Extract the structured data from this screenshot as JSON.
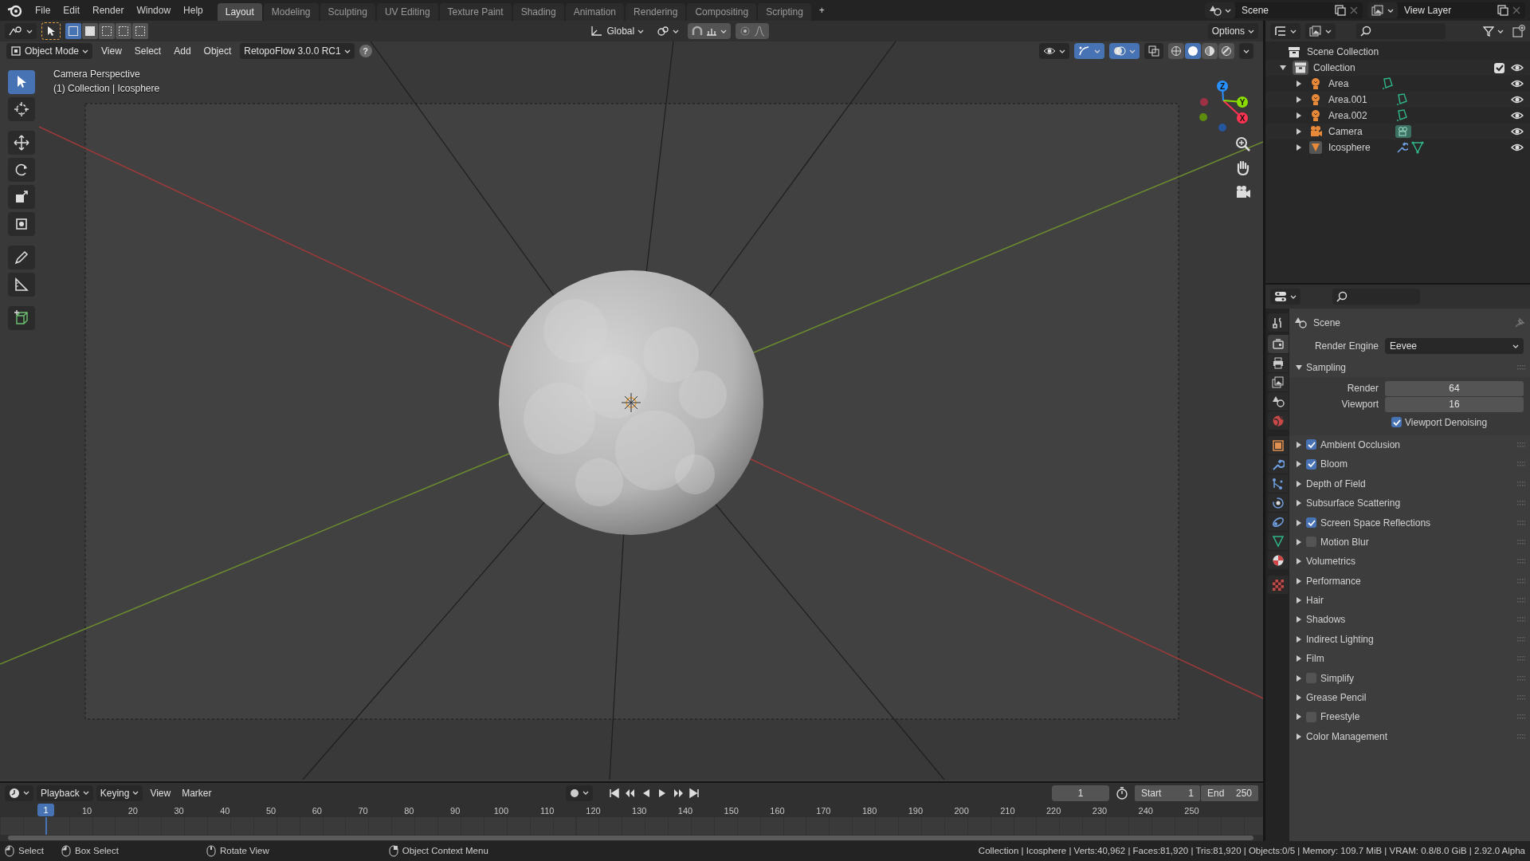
{
  "top_bar": {
    "menus": [
      "File",
      "Edit",
      "Render",
      "Window",
      "Help"
    ],
    "workspace_tabs": [
      {
        "label": "Layout",
        "selected": true
      },
      {
        "label": "Modeling",
        "selected": false
      },
      {
        "label": "Sculpting",
        "selected": false
      },
      {
        "label": "UV Editing",
        "selected": false
      },
      {
        "label": "Texture Paint",
        "selected": false
      },
      {
        "label": "Shading",
        "selected": false
      },
      {
        "label": "Animation",
        "selected": false
      },
      {
        "label": "Rendering",
        "selected": false
      },
      {
        "label": "Compositing",
        "selected": false
      },
      {
        "label": "Scripting",
        "selected": false
      }
    ],
    "add_workspace": "+",
    "scene": "Scene",
    "view_layer": "View Layer"
  },
  "viewport": {
    "transform_orientation": "Global",
    "options": "Options",
    "mode": "Object Mode",
    "menus": [
      "View",
      "Select",
      "Add",
      "Object"
    ],
    "addon": "RetopoFlow 3.0.0 RC1",
    "help": "?",
    "overlay_text": [
      "Camera Perspective",
      "(1) Collection | Icosphere"
    ],
    "gizmo_labels": [
      "X",
      "Y",
      "Z"
    ]
  },
  "outliner": {
    "root": "Scene Collection",
    "collection": {
      "label": "Collection",
      "expanded": true,
      "checked": true,
      "visible": true,
      "children": [
        {
          "label": "Area",
          "kind": "light",
          "expanded": false,
          "has_modifier": false,
          "visible": true
        },
        {
          "label": "Area.001",
          "kind": "light",
          "expanded": false,
          "has_modifier": false,
          "visible": true
        },
        {
          "label": "Area.002",
          "kind": "light",
          "expanded": false,
          "has_modifier": false,
          "visible": true
        },
        {
          "label": "Camera",
          "kind": "camera",
          "expanded": false,
          "has_modifier": false,
          "visible": true
        },
        {
          "label": "Icosphere",
          "kind": "mesh",
          "expanded": false,
          "has_modifier": true,
          "visible": true
        }
      ]
    }
  },
  "properties": {
    "tabs": [
      {
        "kind": "tool",
        "selected": false
      },
      {
        "kind": "render",
        "selected": true
      },
      {
        "kind": "output",
        "selected": false
      },
      {
        "kind": "view_layer",
        "selected": false
      },
      {
        "kind": "scene",
        "selected": false
      },
      {
        "kind": "world",
        "selected": false
      },
      {
        "kind": "object",
        "selected": false
      },
      {
        "kind": "modifiers",
        "selected": false
      },
      {
        "kind": "particles",
        "selected": false
      },
      {
        "kind": "physics",
        "selected": false
      },
      {
        "kind": "constraints",
        "selected": false
      },
      {
        "kind": "data",
        "selected": false
      },
      {
        "kind": "material",
        "selected": false
      },
      {
        "kind": "texture",
        "selected": false
      }
    ],
    "context": "Scene",
    "render_engine": {
      "label": "Render Engine",
      "value": "Eevee"
    },
    "panels": [
      {
        "label": "Sampling",
        "kind": "plain",
        "expanded": true,
        "fields": [
          {
            "label": "Render",
            "value": "64"
          },
          {
            "label": "Viewport",
            "value": "16"
          }
        ],
        "option": {
          "label": "Viewport Denoising",
          "checked": true
        }
      },
      {
        "label": "Ambient Occlusion",
        "kind": "toggle",
        "checked": true,
        "expanded": false
      },
      {
        "label": "Bloom",
        "kind": "toggle",
        "checked": true,
        "expanded": false
      },
      {
        "label": "Depth of Field",
        "kind": "plain",
        "expanded": false
      },
      {
        "label": "Subsurface Scattering",
        "kind": "plain",
        "expanded": false
      },
      {
        "label": "Screen Space Reflections",
        "kind": "toggle",
        "checked": true,
        "expanded": false
      },
      {
        "label": "Motion Blur",
        "kind": "toggle",
        "checked": false,
        "expanded": false
      },
      {
        "label": "Volumetrics",
        "kind": "plain",
        "expanded": false
      },
      {
        "label": "Performance",
        "kind": "plain",
        "expanded": false
      },
      {
        "label": "Hair",
        "kind": "plain",
        "expanded": false
      },
      {
        "label": "Shadows",
        "kind": "plain",
        "expanded": false
      },
      {
        "label": "Indirect Lighting",
        "kind": "plain",
        "expanded": false
      },
      {
        "label": "Film",
        "kind": "plain",
        "expanded": false
      },
      {
        "label": "Simplify",
        "kind": "toggle",
        "checked": false,
        "expanded": false
      },
      {
        "label": "Grease Pencil",
        "kind": "plain",
        "expanded": false
      },
      {
        "label": "Freestyle",
        "kind": "toggle",
        "checked": false,
        "expanded": false
      },
      {
        "label": "Color Management",
        "kind": "plain",
        "expanded": false
      }
    ]
  },
  "timeline": {
    "menus": [
      "Playback",
      "Keying",
      "View",
      "Marker"
    ],
    "current_frame": "1",
    "start": {
      "label": "Start",
      "value": "1"
    },
    "end": {
      "label": "End",
      "value": "250"
    },
    "playhead": "1",
    "ruler": [
      "10",
      "20",
      "30",
      "40",
      "50",
      "60",
      "70",
      "80",
      "90",
      "100",
      "110",
      "120",
      "130",
      "140",
      "150",
      "160",
      "170",
      "180",
      "190",
      "200",
      "210",
      "220",
      "230",
      "240",
      "250"
    ]
  },
  "status_bar": {
    "hints": [
      "Select",
      "Box Select",
      "Rotate View",
      "Object Context Menu"
    ],
    "stats": "Collection | Icosphere | Verts:40,962 | Faces:81,920 | Tris:81,920 | Objects:0/5 | Memory: 109.7 MiB | VRAM: 0.8/8.0 GiB | 2.92.0 Alpha"
  }
}
